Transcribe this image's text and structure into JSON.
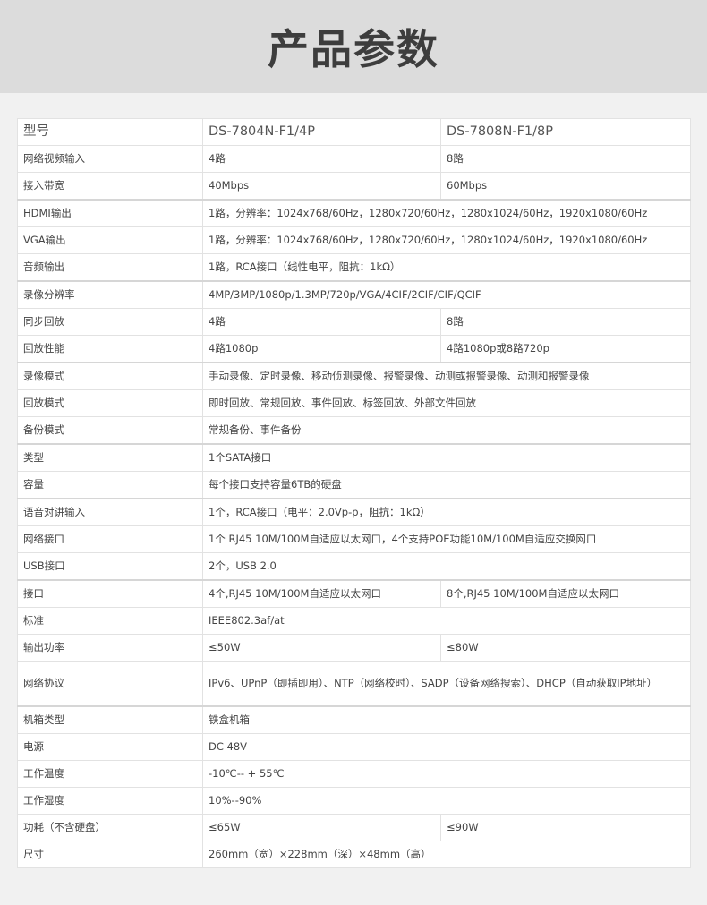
{
  "header": {
    "title": "产品参数"
  },
  "spec": {
    "model_label": "型号",
    "models": [
      "DS-7804N-F1/4P",
      "DS-7808N-F1/8P"
    ],
    "rows": [
      {
        "label": "网络视频输入",
        "values": [
          "4路",
          "8路"
        ]
      },
      {
        "label": "接入带宽",
        "values": [
          "40Mbps",
          "60Mbps"
        ]
      },
      {
        "label": "HDMI输出",
        "values": [
          "1路，分辨率：1024x768/60Hz，1280x720/60Hz，1280x1024/60Hz，1920x1080/60Hz"
        ]
      },
      {
        "label": "VGA输出",
        "values": [
          "1路，分辨率：1024x768/60Hz，1280x720/60Hz，1280x1024/60Hz，1920x1080/60Hz"
        ]
      },
      {
        "label": "音频输出",
        "values": [
          "1路，RCA接口（线性电平，阻抗：1kΩ）"
        ]
      },
      {
        "label": "录像分辨率",
        "values": [
          "4MP/3MP/1080p/1.3MP/720p/VGA/4CIF/2CIF/CIF/QCIF"
        ]
      },
      {
        "label": "同步回放",
        "values": [
          "4路",
          "8路"
        ]
      },
      {
        "label": "回放性能",
        "values": [
          "4路1080p",
          "4路1080p或8路720p"
        ]
      },
      {
        "label": "录像模式",
        "values": [
          "手动录像、定时录像、移动侦测录像、报警录像、动测或报警录像、动测和报警录像"
        ]
      },
      {
        "label": "回放模式",
        "values": [
          "即时回放、常规回放、事件回放、标签回放、外部文件回放"
        ]
      },
      {
        "label": "备份模式",
        "values": [
          "常规备份、事件备份"
        ]
      },
      {
        "label": "类型",
        "values": [
          "1个SATA接口"
        ]
      },
      {
        "label": "容量",
        "values": [
          "每个接口支持容量6TB的硬盘"
        ]
      },
      {
        "label": "语音对讲输入",
        "values": [
          "1个，RCA接口（电平：2.0Vp-p，阻抗：1kΩ）"
        ]
      },
      {
        "label": "网络接口",
        "values": [
          "1个 RJ45 10M/100M自适应以太网口，4个支持POE功能10M/100M自适应交换网口"
        ]
      },
      {
        "label": "USB接口",
        "values": [
          "2个，USB 2.0"
        ]
      },
      {
        "label": "接口",
        "values": [
          "4个,RJ45 10M/100M自适应以太网口",
          "8个,RJ45 10M/100M自适应以太网口"
        ]
      },
      {
        "label": "标准",
        "values": [
          "IEEE802.3af/at"
        ]
      },
      {
        "label": "输出功率",
        "values": [
          "≤50W",
          "≤80W"
        ]
      },
      {
        "label": "网络协议",
        "values": [
          "IPv6、UPnP（即插即用）、NTP（网络校时）、SADP（设备网络搜索）、DHCP（自动获取IP地址）"
        ]
      },
      {
        "label": "机箱类型",
        "values": [
          "铁盒机箱"
        ]
      },
      {
        "label": "电源",
        "values": [
          "DC 48V"
        ]
      },
      {
        "label": "工作温度",
        "values": [
          "-10℃-- + 55℃"
        ]
      },
      {
        "label": "工作湿度",
        "values": [
          "10%--90%"
        ]
      },
      {
        "label": "功耗（不含硬盘）",
        "values": [
          "≤65W",
          "≤90W"
        ]
      },
      {
        "label": "尺寸",
        "values": [
          "260mm（宽）×228mm（深）×48mm（高）"
        ]
      }
    ]
  }
}
